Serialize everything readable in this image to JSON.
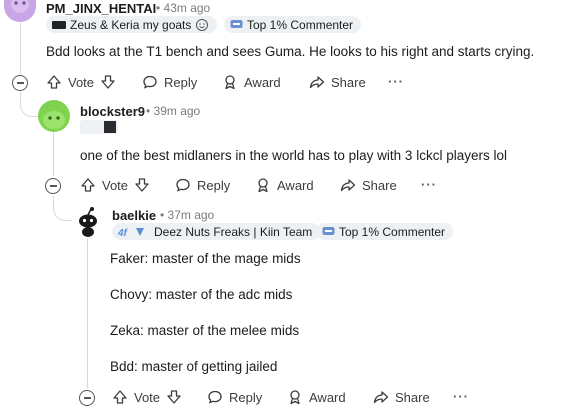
{
  "comments": [
    {
      "username": "PM_JINX_HENTAI",
      "time": "• 43m ago",
      "flair": "Zeus & Keria my goats",
      "badge": "Top 1% Commenter",
      "body": "Bdd looks at the T1 bench and sees Guma. He looks to his right and starts crying."
    },
    {
      "username": "blockster9",
      "time": "• 39m ago",
      "body": "one of the best midlaners in the world has to play with 3 lckcl players lol"
    },
    {
      "username": "baelkie",
      "time": "• 37m ago",
      "flair": "Deez Nuts Freaks | Kiin Team",
      "badge": "Top 1% Commenter",
      "lines": [
        "Faker: master of the mage mids",
        "Chovy: master of the adc mids",
        "Zeka: master of the melee mids",
        "Bdd: master of getting jailed"
      ]
    }
  ],
  "actions": {
    "vote": "Vote",
    "reply": "Reply",
    "award": "Award",
    "share": "Share",
    "more": "···"
  },
  "colors": {
    "avatar_1": "#c8a6e6",
    "avatar_2": "#7fd34f",
    "badge_icon": "#6a8fcf",
    "thread_line": "#d7dadc"
  }
}
